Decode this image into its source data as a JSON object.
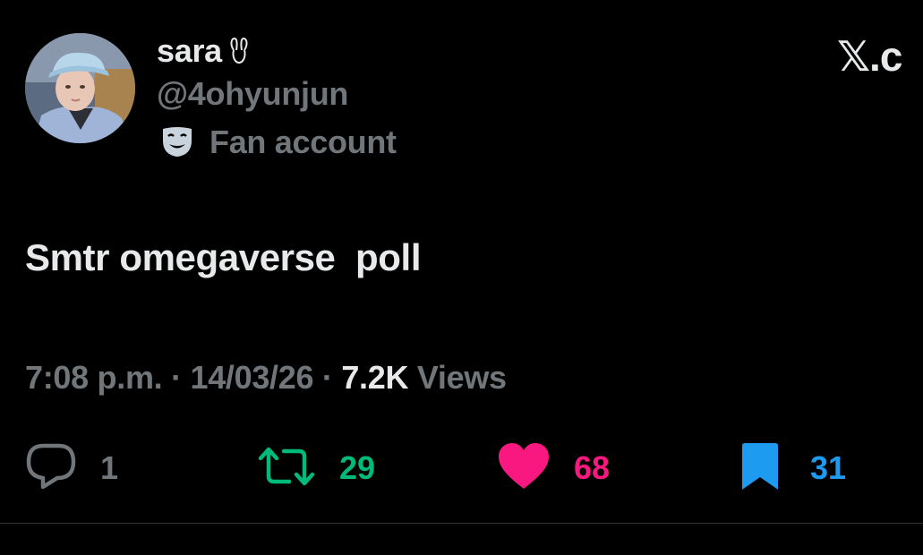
{
  "colors": {
    "background": "#000000",
    "primary_text": "#e7e9ea",
    "secondary_text": "#71767b",
    "retweet": "#00ba7c",
    "like": "#f91880",
    "bookmark": "#1d9bf0",
    "divider": "#2f3336"
  },
  "author": {
    "display_name": "sara",
    "name_emoji": "🐰",
    "handle": "@4ohyunjun",
    "account_label": "Fan account",
    "label_icon": "theater-mask-icon",
    "avatar": "profile-photo"
  },
  "brand": {
    "logo": "𝕏.c"
  },
  "tweet": {
    "text": "Smtr omegaverse  poll"
  },
  "meta": {
    "time": "7:08 p.m.",
    "separator": "·",
    "date": "14/03/26",
    "views_count": "7.2K",
    "views_label": "Views"
  },
  "actions": {
    "reply": {
      "icon": "reply-icon",
      "count": "1"
    },
    "retweet": {
      "icon": "retweet-icon",
      "count": "29"
    },
    "like": {
      "icon": "heart-icon",
      "count": "68"
    },
    "bookmark": {
      "icon": "bookmark-icon",
      "count": "31"
    }
  }
}
